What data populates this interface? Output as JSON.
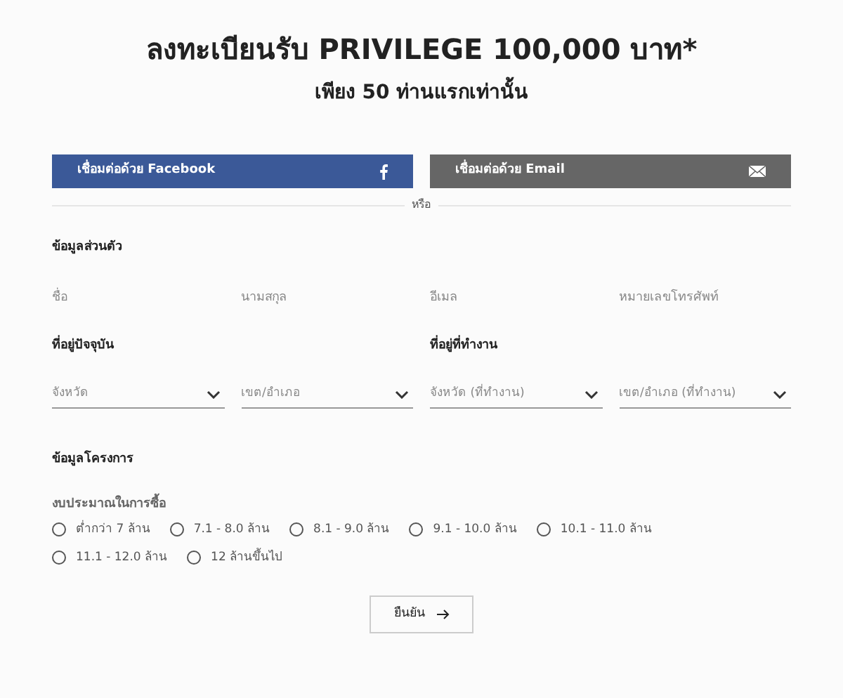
{
  "header": {
    "title": "ลงทะเบียนรับ PRIVILEGE 100,000 บาท*",
    "subtitle": "เพียง 50 ท่านแรกเท่านั้น"
  },
  "connect_buttons": [
    {
      "label": "เชื่อมต่อด้วย Facebook",
      "kind": "facebook"
    },
    {
      "label": "เชื่อมต่อด้วย Email",
      "kind": "email"
    }
  ],
  "divider_text": "หรือ",
  "personal": {
    "heading": "ข้อมูลส่วนตัว",
    "fields": [
      {
        "placeholder": "ชื่อ"
      },
      {
        "placeholder": "นามสกุล"
      },
      {
        "placeholder": "อีเมล"
      },
      {
        "placeholder": "หมายเลขโทรศัพท์"
      }
    ]
  },
  "addresses": [
    {
      "heading": "ที่อยู่ปัจจุบัน",
      "selects": [
        {
          "placeholder": "จังหวัด"
        },
        {
          "placeholder": "เขต/อำเภอ"
        }
      ]
    },
    {
      "heading": "ที่อยู่ที่ทำงาน",
      "selects": [
        {
          "placeholder": "จังหวัด (ที่ทำงาน)"
        },
        {
          "placeholder": "เขต/อำเภอ (ที่ทำงาน)"
        }
      ]
    }
  ],
  "project": {
    "heading": "ข้อมูลโครงการ",
    "budget_label": "งบประมาณในการซื้อ",
    "options": [
      {
        "label": "ต่ำกว่า 7 ล้าน",
        "selected": false
      },
      {
        "label": "7.1 - 8.0 ล้าน",
        "selected": false
      },
      {
        "label": "8.1 - 9.0 ล้าน",
        "selected": false
      },
      {
        "label": "9.1 - 10.0 ล้าน",
        "selected": false
      },
      {
        "label": "10.1 - 11.0 ล้าน",
        "selected": false
      },
      {
        "label": "11.1 - 12.0 ล้าน",
        "selected": false
      },
      {
        "label": "12 ล้านขึ้นไป",
        "selected": false
      }
    ]
  },
  "submit": {
    "label": "ยืนยัน"
  }
}
